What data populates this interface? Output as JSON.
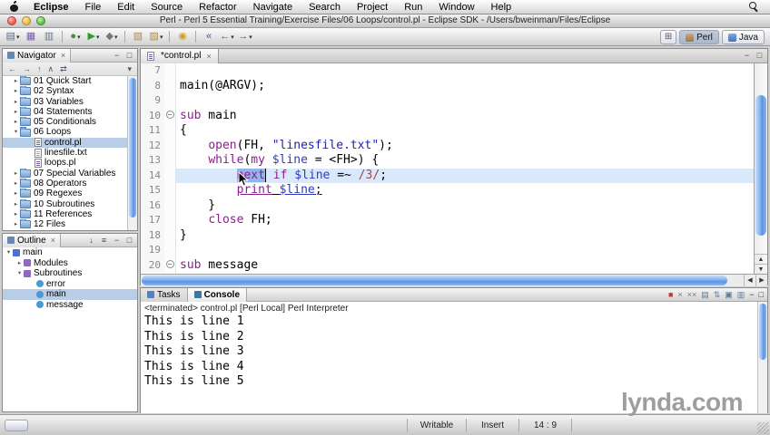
{
  "menu_bar": {
    "items": [
      "Eclipse",
      "File",
      "Edit",
      "Source",
      "Refactor",
      "Navigate",
      "Search",
      "Project",
      "Run",
      "Window",
      "Help"
    ]
  },
  "window": {
    "title": "Perl - Perl 5 Essential Training/Exercise Files/06 Loops/control.pl - Eclipse SDK - /Users/bweinman/Files/Eclipse"
  },
  "toolbar": {
    "buttons": [
      {
        "name": "new-wizard",
        "glyph": "▤",
        "cls": "c-new",
        "dd": true
      },
      {
        "name": "save",
        "glyph": "▦",
        "cls": "c-save"
      },
      {
        "name": "print",
        "glyph": "▥",
        "cls": "c-print"
      },
      {
        "sep": true
      },
      {
        "name": "debug",
        "glyph": "●",
        "cls": "c-debug",
        "dd": true
      },
      {
        "name": "run",
        "glyph": "▶",
        "cls": "c-run",
        "dd": true
      },
      {
        "name": "external-tools",
        "glyph": "◆",
        "cls": "c-tools",
        "dd": true
      },
      {
        "sep": true
      },
      {
        "name": "new-perl-project",
        "glyph": "▧",
        "cls": "c-perl"
      },
      {
        "name": "new-perl-file",
        "glyph": "▨",
        "cls": "c-perl",
        "dd": true
      },
      {
        "sep": true
      },
      {
        "name": "search",
        "glyph": "◉",
        "cls": "c-search"
      },
      {
        "sep": true
      },
      {
        "name": "last-edit-location",
        "glyph": "«",
        "cls": "c-nav"
      },
      {
        "name": "back",
        "glyph": "←",
        "cls": "c-nav",
        "dd": true
      },
      {
        "name": "forward",
        "glyph": "→",
        "cls": "c-nav",
        "dd": true
      }
    ]
  },
  "perspectives": [
    {
      "label": "Perl",
      "active": true
    },
    {
      "label": "Java",
      "active": false
    }
  ],
  "navigator": {
    "title": "Navigator",
    "toolbar": [
      {
        "name": "back",
        "glyph": "←"
      },
      {
        "name": "forward",
        "glyph": "→"
      },
      {
        "name": "up",
        "glyph": "↑"
      },
      {
        "name": "collapse-all",
        "glyph": "∧"
      },
      {
        "name": "link-with-editor",
        "glyph": "⇄"
      }
    ],
    "items": [
      {
        "label": "01 Quick Start",
        "depth": 1,
        "icon": "folder",
        "disc": "closed"
      },
      {
        "label": "02 Syntax",
        "depth": 1,
        "icon": "folder",
        "disc": "closed"
      },
      {
        "label": "03 Variables",
        "depth": 1,
        "icon": "folder",
        "disc": "closed"
      },
      {
        "label": "04 Statements",
        "depth": 1,
        "icon": "folder",
        "disc": "closed"
      },
      {
        "label": "05 Conditionals",
        "depth": 1,
        "icon": "folder",
        "disc": "closed"
      },
      {
        "label": "06 Loops",
        "depth": 1,
        "icon": "folder",
        "disc": "open"
      },
      {
        "label": "control.pl",
        "depth": 2,
        "icon": "perl-file",
        "selected": true
      },
      {
        "label": "linesfile.txt",
        "depth": 2,
        "icon": "text-file"
      },
      {
        "label": "loops.pl",
        "depth": 2,
        "icon": "perl-file"
      },
      {
        "label": "07 Special Variables",
        "depth": 1,
        "icon": "folder",
        "disc": "closed"
      },
      {
        "label": "08 Operators",
        "depth": 1,
        "icon": "folder",
        "disc": "closed"
      },
      {
        "label": "09 Regexes",
        "depth": 1,
        "icon": "folder",
        "disc": "closed"
      },
      {
        "label": "10 Subroutines",
        "depth": 1,
        "icon": "folder",
        "disc": "closed"
      },
      {
        "label": "11 References",
        "depth": 1,
        "icon": "folder",
        "disc": "closed"
      },
      {
        "label": "12 Files",
        "depth": 1,
        "icon": "folder",
        "disc": "closed"
      }
    ]
  },
  "outline": {
    "title": "Outline",
    "items": [
      {
        "label": "main",
        "depth": 0,
        "icon": "module",
        "disc": "open"
      },
      {
        "label": "Modules",
        "depth": 1,
        "icon": "group",
        "disc": "closed"
      },
      {
        "label": "Subroutines",
        "depth": 1,
        "icon": "group",
        "disc": "open"
      },
      {
        "label": "error",
        "depth": 2,
        "icon": "sub"
      },
      {
        "label": "main",
        "depth": 2,
        "icon": "sub",
        "selected": true
      },
      {
        "label": "message",
        "depth": 2,
        "icon": "sub"
      }
    ]
  },
  "editor": {
    "tab": "*control.pl",
    "lines": [
      {
        "n": 7,
        "seg": []
      },
      {
        "n": 8,
        "seg": [
          {
            "t": "main(@ARGV);",
            "c": "p"
          }
        ]
      },
      {
        "n": 9,
        "seg": []
      },
      {
        "n": 10,
        "fold": true,
        "seg": [
          {
            "t": "sub",
            "c": "k"
          },
          {
            "t": " main",
            "c": "p"
          }
        ]
      },
      {
        "n": 11,
        "seg": [
          {
            "t": "{",
            "c": "p"
          }
        ]
      },
      {
        "n": 12,
        "seg": [
          {
            "t": "    ",
            "c": "p"
          },
          {
            "t": "open",
            "c": "k"
          },
          {
            "t": "(FH, ",
            "c": "p"
          },
          {
            "t": "\"linesfile.txt\"",
            "c": "s"
          },
          {
            "t": ");",
            "c": "p"
          }
        ]
      },
      {
        "n": 13,
        "seg": [
          {
            "t": "    ",
            "c": "p"
          },
          {
            "t": "while",
            "c": "k"
          },
          {
            "t": "(",
            "c": "p"
          },
          {
            "t": "my",
            "c": "k"
          },
          {
            "t": " ",
            "c": "p"
          },
          {
            "t": "$line",
            "c": "v"
          },
          {
            "t": " = <FH>) {",
            "c": "p"
          }
        ]
      },
      {
        "n": 14,
        "current": true,
        "seg": [
          {
            "t": "        ",
            "c": "p"
          },
          {
            "t": "next",
            "c": "k",
            "sel": true
          },
          {
            "t": " ",
            "c": "p",
            "caret": true
          },
          {
            "t": "if",
            "c": "k"
          },
          {
            "t": " ",
            "c": "p"
          },
          {
            "t": "$line",
            "c": "v"
          },
          {
            "t": " =~ ",
            "c": "p"
          },
          {
            "t": "/3/",
            "c": "r"
          },
          {
            "t": ";",
            "c": "p"
          }
        ]
      },
      {
        "n": 15,
        "seg": [
          {
            "t": "        ",
            "c": "p"
          },
          {
            "t": "print",
            "c": "k",
            "u": true
          },
          {
            "t": " ",
            "c": "p",
            "u": true
          },
          {
            "t": "$line",
            "c": "v",
            "u": true
          },
          {
            "t": ";",
            "c": "p",
            "u": true
          }
        ]
      },
      {
        "n": 16,
        "seg": [
          {
            "t": "    }",
            "c": "p"
          }
        ]
      },
      {
        "n": 17,
        "seg": [
          {
            "t": "    ",
            "c": "p"
          },
          {
            "t": "close",
            "c": "k"
          },
          {
            "t": " FH;",
            "c": "p"
          }
        ]
      },
      {
        "n": 18,
        "seg": [
          {
            "t": "}",
            "c": "p"
          }
        ]
      },
      {
        "n": 19,
        "seg": []
      },
      {
        "n": 20,
        "fold": true,
        "seg": [
          {
            "t": "sub",
            "c": "k"
          },
          {
            "t": " message",
            "c": "p"
          }
        ]
      }
    ]
  },
  "console": {
    "tabs": [
      {
        "label": "Tasks",
        "active": false
      },
      {
        "label": "Console",
        "active": true
      }
    ],
    "status_line": "<terminated> control.pl [Perl Local] Perl Interpreter",
    "toolbar": [
      {
        "name": "terminate",
        "glyph": "■",
        "cls": "k-red"
      },
      {
        "name": "remove-launch",
        "glyph": "×",
        "cls": "k-gray"
      },
      {
        "name": "remove-all-launches",
        "glyph": "××",
        "cls": "k-gray"
      },
      {
        "name": "clear-console",
        "glyph": "▤",
        "cls": "k-blue"
      },
      {
        "name": "scroll-lock",
        "glyph": "⇅",
        "cls": "k-blue"
      },
      {
        "name": "pin-console",
        "glyph": "▣",
        "cls": "k-blue"
      },
      {
        "name": "open-console",
        "glyph": "▥",
        "cls": "k-blue"
      },
      {
        "name": "minimize",
        "glyph": "−",
        "cls": "k-dark"
      },
      {
        "name": "maximize",
        "glyph": "□",
        "cls": "k-dark"
      }
    ],
    "output": [
      "This is line 1",
      "This is line 2",
      "This is line 3",
      "This is line 4",
      "This is line 5"
    ]
  },
  "status_bar": {
    "writable": "Writable",
    "insert": "Insert",
    "position": "14 : 9"
  },
  "watermark": "lynda.com",
  "colors": {
    "keyword": "#8c1d8c",
    "variable": "#2f3bbf",
    "string": "#1f1fa8",
    "regex": "#a04545",
    "selection": "#8fb6ea",
    "current_line": "#d9e9fb",
    "aqua_scrollbar": "#82b0ef",
    "selection_tree": "#b9cde6"
  }
}
